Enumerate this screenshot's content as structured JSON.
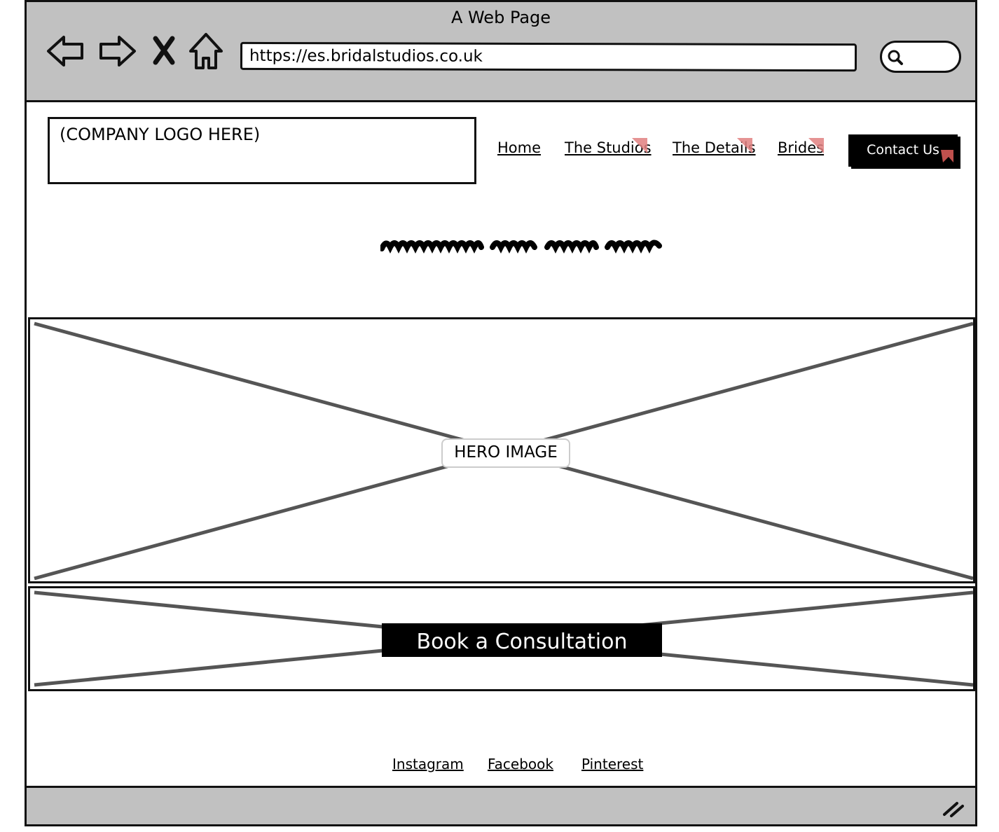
{
  "window": {
    "title": "A Web Page"
  },
  "browser": {
    "url": "https://es.bridalstudios.co.uk",
    "icons": [
      "back-arrow-icon",
      "forward-arrow-icon",
      "stop-icon",
      "home-icon",
      "search-icon"
    ]
  },
  "header": {
    "logo_placeholder": "(COMPANY LOGO HERE)",
    "nav": [
      "Home",
      "The Studios",
      "The Details",
      "Brides"
    ],
    "contact_label": "Contact Us"
  },
  "hero": {
    "label": "HERO IMAGE"
  },
  "cta": {
    "label": "Book a Consultation"
  },
  "footer": {
    "links": [
      "Instagram",
      "Facebook",
      "Pinterest"
    ]
  },
  "colors": {
    "chrome": "#c1c1c1",
    "accent_marker": "#e08080",
    "ink": "#000000"
  }
}
